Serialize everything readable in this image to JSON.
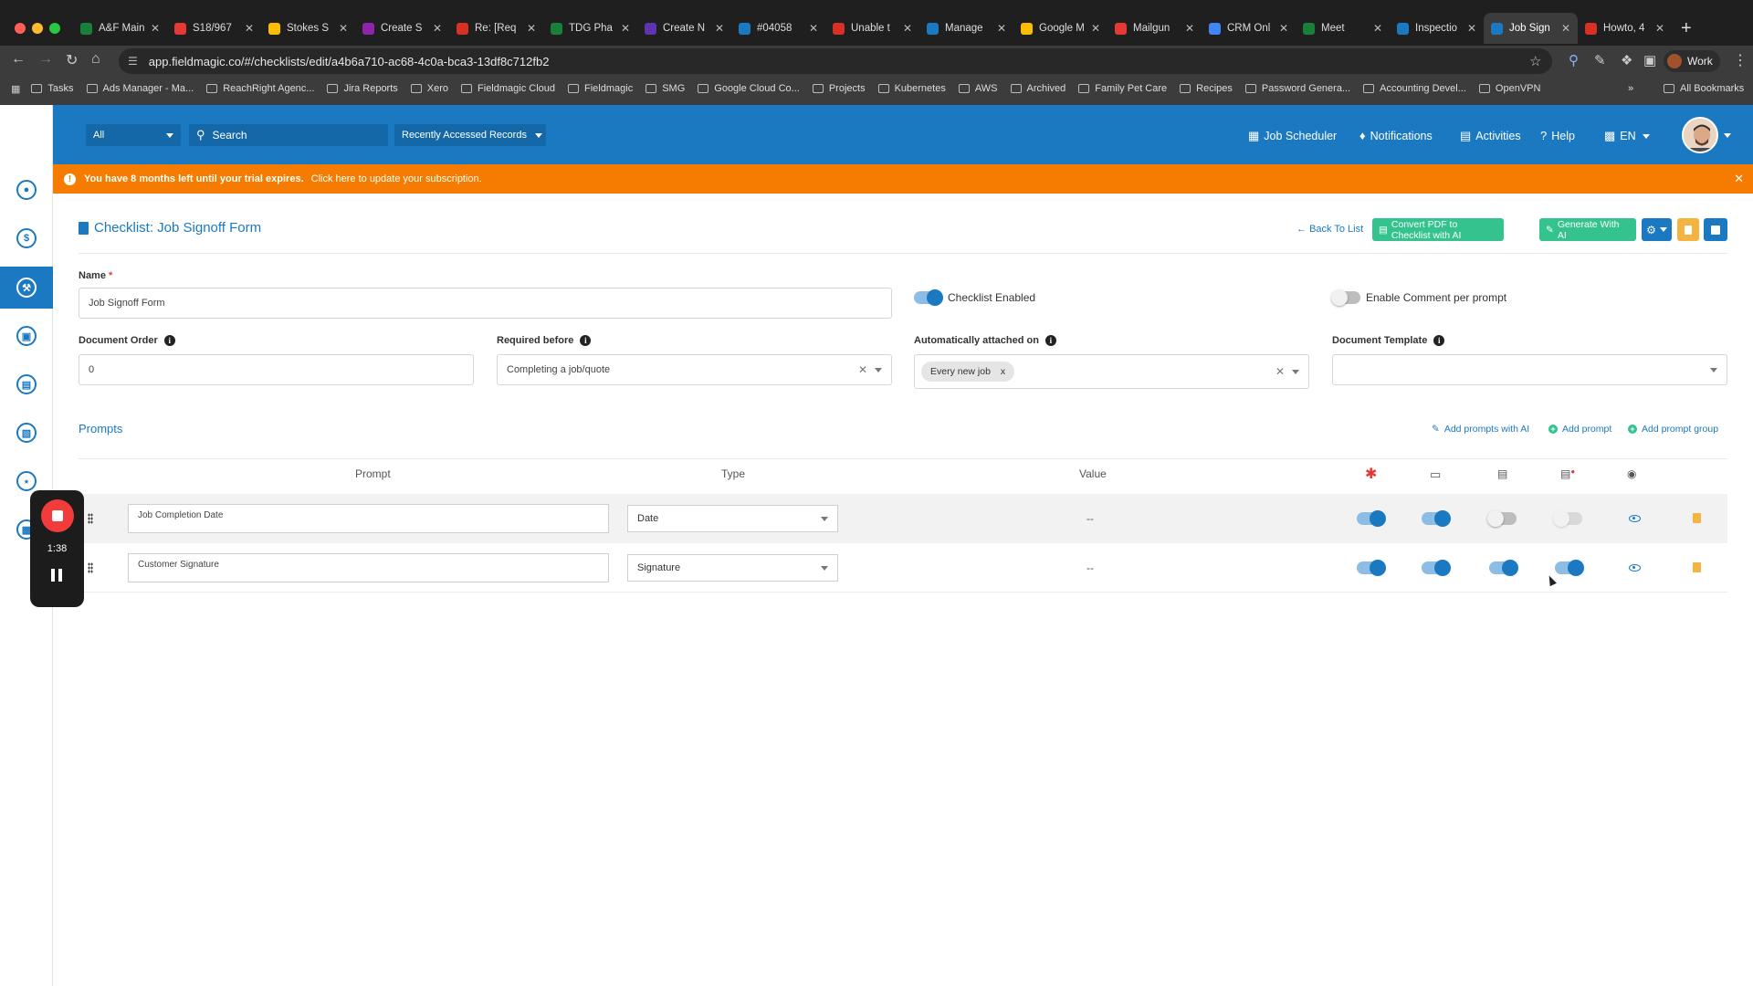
{
  "browser": {
    "tabs": [
      {
        "label": "A&F Main",
        "color": "#188038"
      },
      {
        "label": "S18/967",
        "color": "#e53935"
      },
      {
        "label": "Stokes S",
        "color": "#fbbc04"
      },
      {
        "label": "Create S",
        "color": "#8e24aa"
      },
      {
        "label": "Re: [Req",
        "color": "#d93025"
      },
      {
        "label": "TDG Pha",
        "color": "#188038"
      },
      {
        "label": "Create N",
        "color": "#5e35b1"
      },
      {
        "label": "#04058",
        "color": "#1b79c1"
      },
      {
        "label": "Unable t",
        "color": "#d93025"
      },
      {
        "label": "Manage",
        "color": "#1b79c1"
      },
      {
        "label": "Google M",
        "color": "#fbbc04"
      },
      {
        "label": "Mailgun",
        "color": "#e53935"
      },
      {
        "label": "CRM Onl",
        "color": "#4285f4"
      },
      {
        "label": "Meet",
        "color": "#188038"
      },
      {
        "label": "Inspectio",
        "color": "#1b79c1"
      },
      {
        "label": "Job Sign",
        "color": "#1b79c1",
        "active": true
      },
      {
        "label": "Howto, 4",
        "color": "#d93025"
      }
    ],
    "url": "app.fieldmagic.co/#/checklists/edit/a4b6a710-ac68-4c0a-bca3-13df8c712fb2",
    "profile": "Work",
    "bookmarks": [
      "Tasks",
      "Ads Manager - Ma...",
      "ReachRight Agenc...",
      "Jira Reports",
      "Xero",
      "Fieldmagic Cloud",
      "Fieldmagic",
      "SMG",
      "Google Cloud Co...",
      "Projects",
      "Kubernetes",
      "AWS",
      "Archived",
      "Family Pet Care",
      "Recipes",
      "Password Genera...",
      "Accounting Devel...",
      "OpenVPN"
    ],
    "all_bookmarks": "All Bookmarks",
    "more": "»"
  },
  "header": {
    "filter": "All",
    "search_placeholder": "Search",
    "recent": "Recently Accessed Records",
    "job_scheduler": "Job Scheduler",
    "notifications": "Notifications",
    "activities": "Activities",
    "help": "Help",
    "lang": "EN"
  },
  "trial": {
    "bold": "You have 8 months left until your trial expires.",
    "link": "Click here to update your subscription."
  },
  "page": {
    "title": "Checklist: Job Signoff Form",
    "back": "Back To List",
    "convert_pdf": "Convert PDF to Checklist with AI",
    "generate_ai": "Generate With AI"
  },
  "form": {
    "name_label": "Name",
    "name_value": "Job Signoff Form",
    "checklist_enabled": "Checklist Enabled",
    "enable_comment": "Enable Comment per prompt",
    "doc_order_label": "Document Order",
    "doc_order_value": "0",
    "required_before_label": "Required before",
    "required_before_value": "Completing a job/quote",
    "auto_attached_label": "Automatically attached on",
    "auto_attached_chip": "Every new job",
    "doc_template_label": "Document Template",
    "doc_template_value": ""
  },
  "prompts": {
    "title": "Prompts",
    "add_ai": "Add prompts with AI",
    "add_prompt": "Add prompt",
    "add_group": "Add prompt group",
    "headers": {
      "prompt": "Prompt",
      "type": "Type",
      "value": "Value"
    },
    "rows": [
      {
        "prompt": "Job Completion Date",
        "type": "Date",
        "value": "--",
        "required": true,
        "desktop": true,
        "document": false,
        "doc_required": false
      },
      {
        "prompt": "Customer Signature",
        "type": "Signature",
        "value": "--",
        "required": true,
        "desktop": true,
        "document": true,
        "doc_required": true
      }
    ]
  },
  "recorder": {
    "time": "1:38"
  },
  "colors": {
    "brand": "#1b79c1",
    "trial": "#f57c00",
    "ai_green": "#34c38f",
    "delete": "#f5b342"
  }
}
